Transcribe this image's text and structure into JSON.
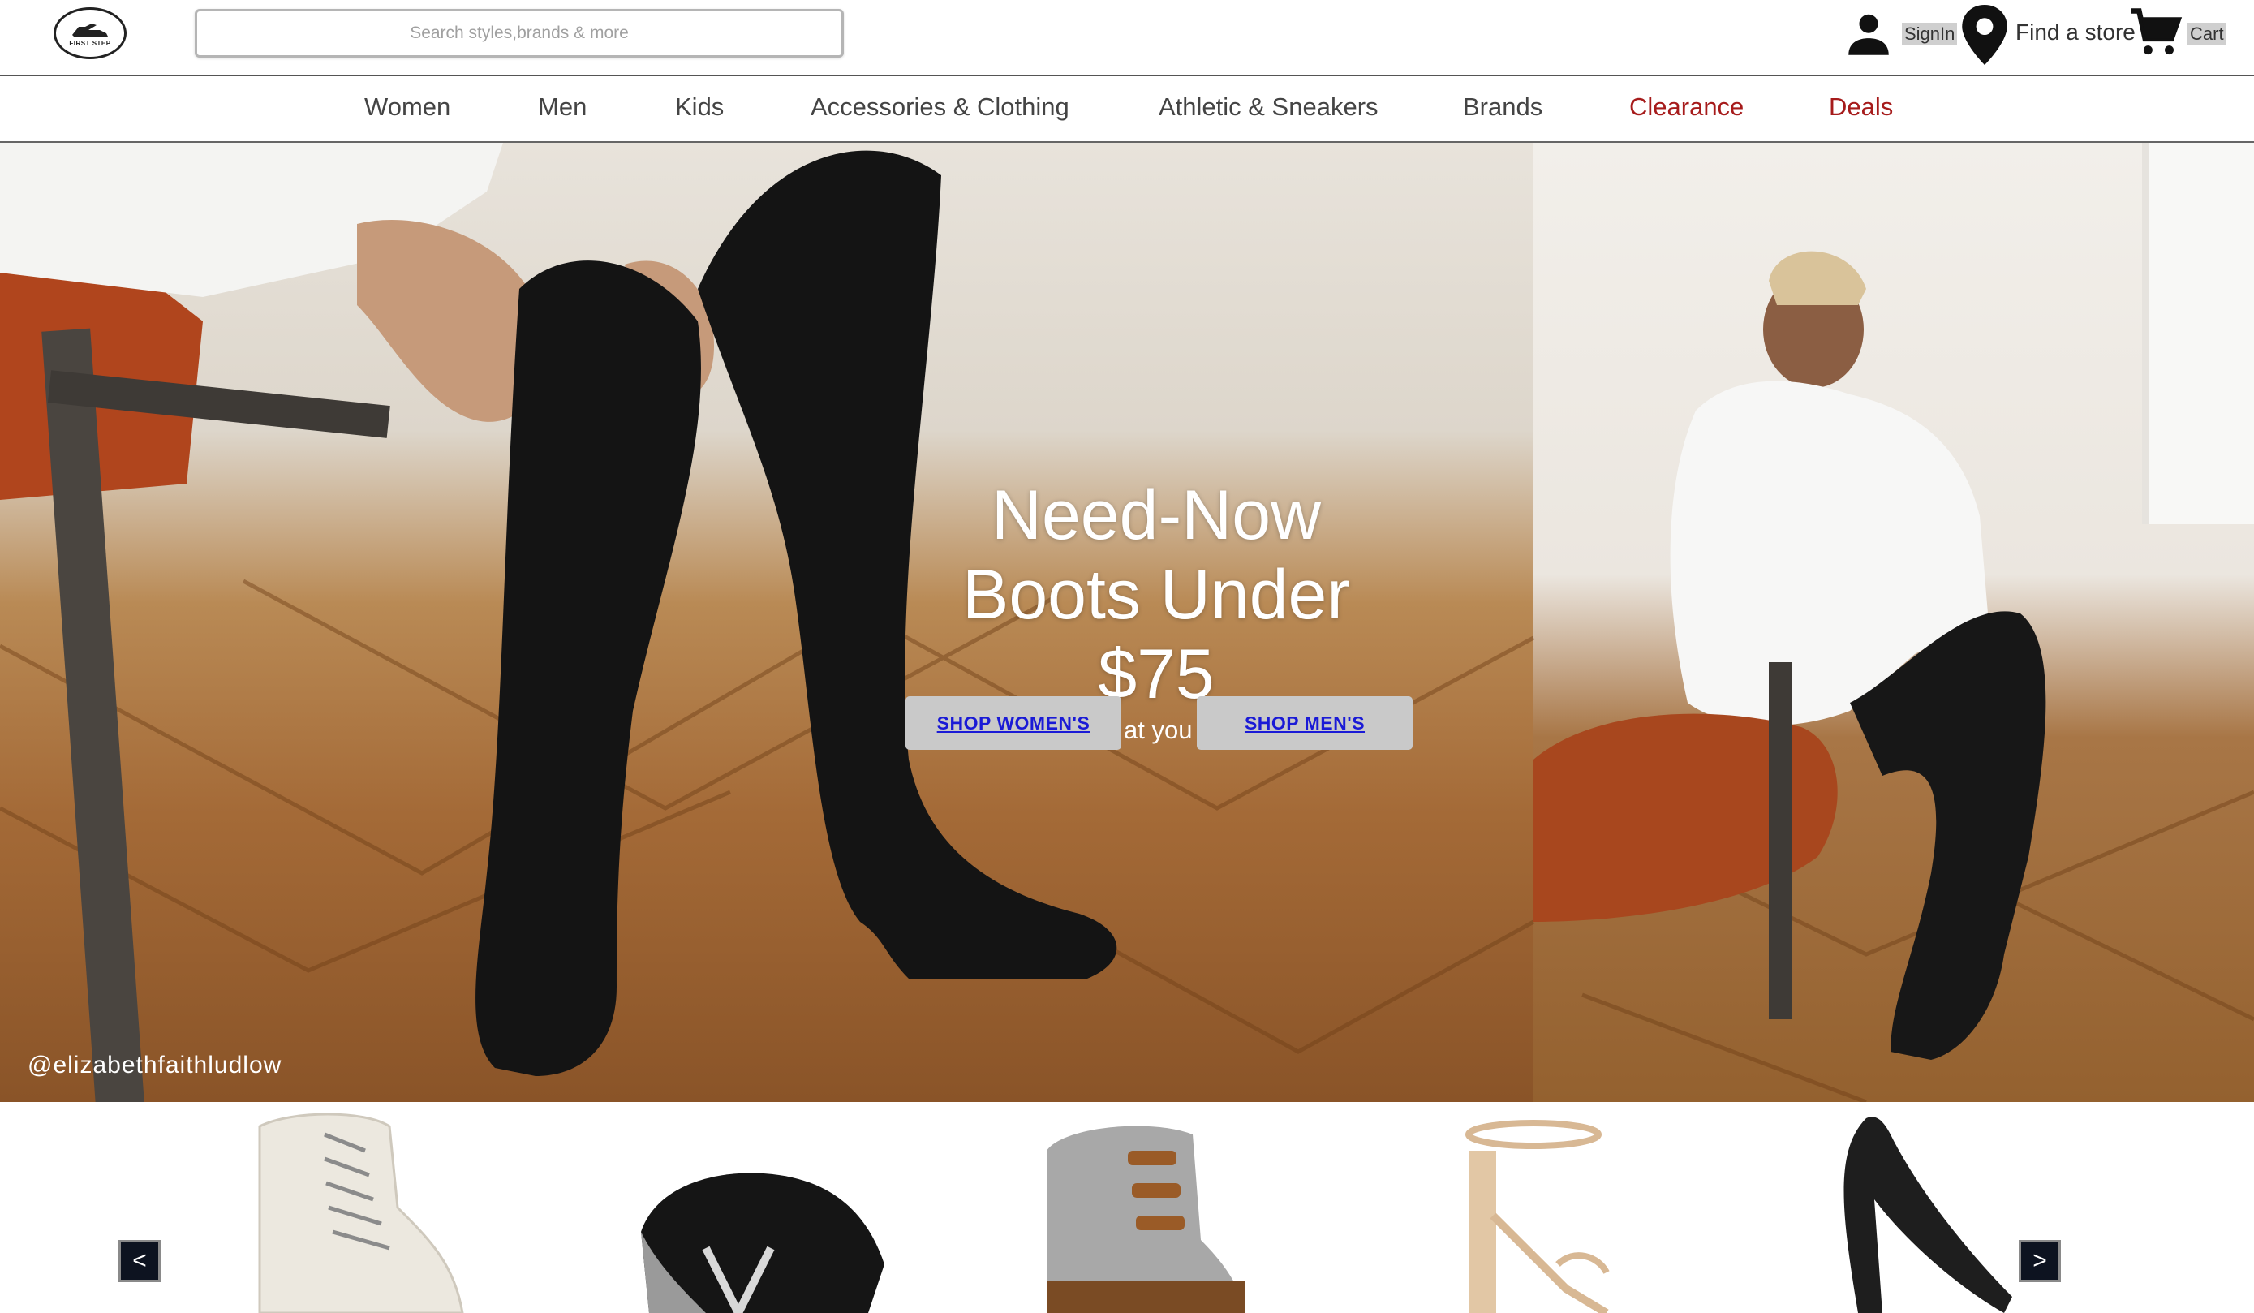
{
  "header": {
    "logo_text": "FIRST STEP",
    "search_placeholder": "Search styles,brands & more",
    "signin_label": "SignIn",
    "store_label": "Find a store",
    "cart_label": "Cart",
    "icons": [
      "logo-icon",
      "user-icon",
      "location-pin-icon",
      "cart-icon"
    ]
  },
  "nav": {
    "items": [
      {
        "label": "Women",
        "color": "#444444"
      },
      {
        "label": "Men",
        "color": "#444444"
      },
      {
        "label": "Kids",
        "color": "#444444"
      },
      {
        "label": "Accessories & Clothing",
        "color": "#444444"
      },
      {
        "label": "Athletic & Sneakers",
        "color": "#444444"
      },
      {
        "label": "Brands",
        "color": "#444444"
      },
      {
        "label": "Clearance",
        "color": "#a61b1b"
      },
      {
        "label": "Deals",
        "color": "#a61b1b"
      }
    ]
  },
  "hero": {
    "headline_1": "Need-Now",
    "headline_2": "Boots Under",
    "headline_3": "$75",
    "subtext": "at you",
    "button_women": "SHOP WOMEN'S",
    "button_men": "SHOP MEN'S",
    "credit": "@elizabethfaithludlow"
  },
  "carousel": {
    "prev_label": "<",
    "next_label": ">",
    "products": [
      "white lace-up boot",
      "black New Balance sneaker",
      "grey duck boot",
      "rose gold strappy heel",
      "black pointed pump"
    ]
  }
}
